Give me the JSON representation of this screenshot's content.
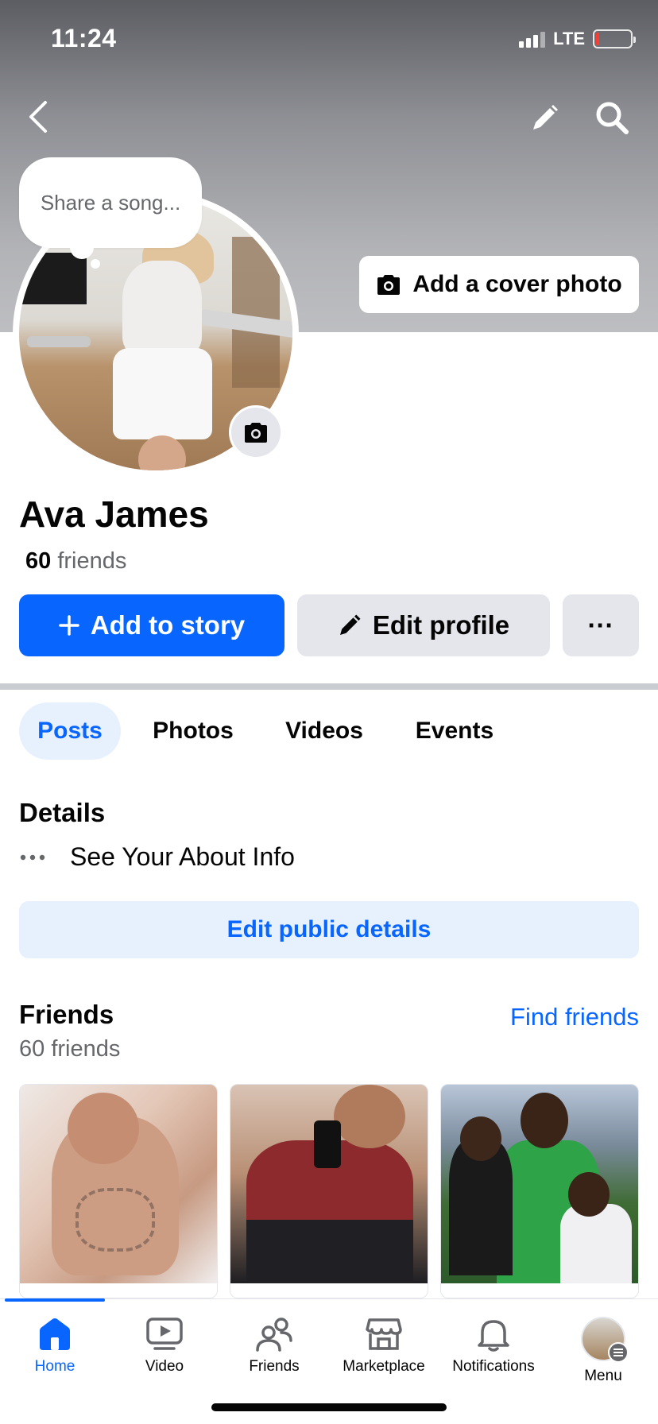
{
  "status_bar": {
    "time": "11:24",
    "network": "LTE"
  },
  "header": {
    "cover_button_label": "Add a cover photo"
  },
  "song_bubble": {
    "placeholder": "Share a song..."
  },
  "profile": {
    "name": "Ava James",
    "friends_count": "60",
    "friends_word": "friends"
  },
  "actions": {
    "add_story_label": "Add to story",
    "edit_profile_label": "Edit profile",
    "more_label": "···"
  },
  "tabs": [
    {
      "label": "Posts",
      "active": true
    },
    {
      "label": "Photos",
      "active": false
    },
    {
      "label": "Videos",
      "active": false
    },
    {
      "label": "Events",
      "active": false
    }
  ],
  "details": {
    "title": "Details",
    "about_label": "See Your About Info",
    "edit_button": "Edit public details"
  },
  "friends_section": {
    "title": "Friends",
    "subtitle": "60 friends",
    "find_link": "Find friends"
  },
  "bottom_nav": [
    {
      "label": "Home",
      "icon": "home-icon",
      "active": true
    },
    {
      "label": "Video",
      "icon": "video-icon",
      "active": false
    },
    {
      "label": "Friends",
      "icon": "friends-icon",
      "active": false
    },
    {
      "label": "Marketplace",
      "icon": "marketplace-icon",
      "active": false
    },
    {
      "label": "Notifications",
      "icon": "bell-icon",
      "active": false
    },
    {
      "label": "Menu",
      "icon": "avatar",
      "active": false
    }
  ],
  "colors": {
    "accent": "#0866ff",
    "accent_light": "#e7f0fd",
    "secondary_bg": "#e4e6eb",
    "text_secondary": "#65676b"
  }
}
